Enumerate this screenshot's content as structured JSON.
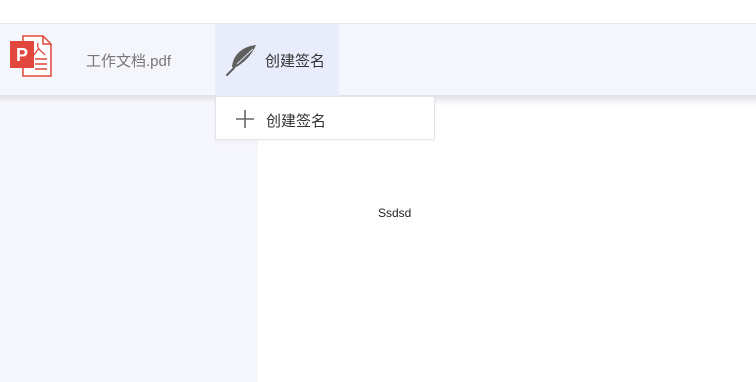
{
  "header": {
    "file_icon": "pdf-file-icon",
    "file_name": "工作文档.pdf",
    "sign_tab": {
      "icon": "feather-icon",
      "label": "创建签名"
    }
  },
  "dropdown": {
    "items": [
      {
        "icon": "plus-icon",
        "label": "创建签名"
      }
    ]
  },
  "document": {
    "text": "Ssdsd"
  },
  "colors": {
    "pdf_red": "#e1473c",
    "topbar_bg": "#f5f6fc",
    "active_tab_bg": "#e9edfb",
    "sidebar_bg": "#f6f7fd"
  }
}
